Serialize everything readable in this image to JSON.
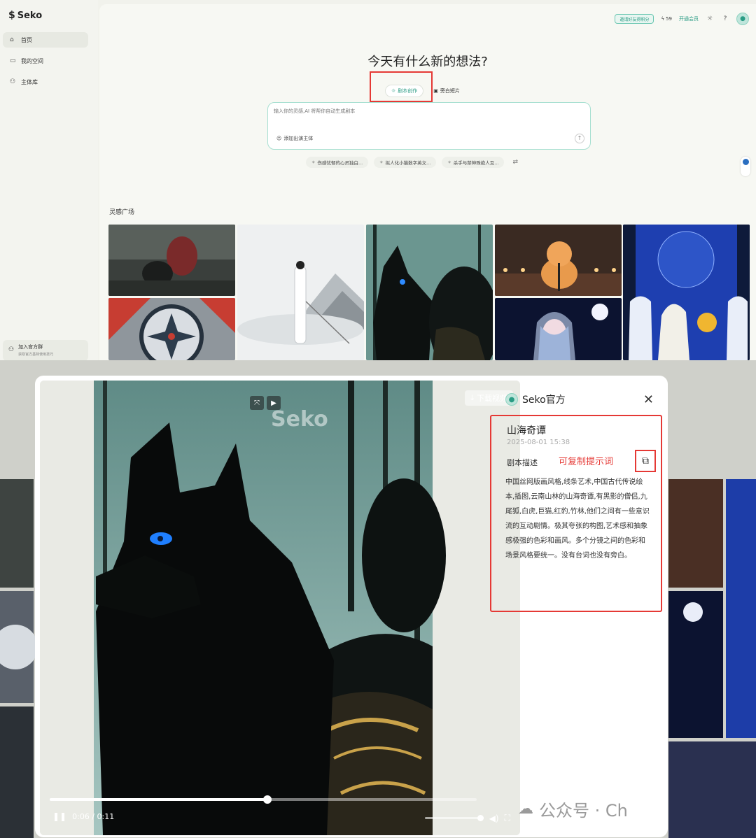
{
  "app": {
    "logo": "Seko",
    "nav": [
      {
        "label": "首页",
        "icon": "home-icon",
        "glyph": "⌂"
      },
      {
        "label": "我的空间",
        "icon": "folder-icon",
        "glyph": "▭"
      },
      {
        "label": "主体库",
        "icon": "people-icon",
        "glyph": "⚇"
      }
    ],
    "join_group": {
      "title": "加入官方群",
      "subtitle": "获取官方基础使用技巧"
    }
  },
  "topbar": {
    "invite_label": "邀请好友得积分",
    "credits": "59",
    "open_member": "开通会员"
  },
  "headline": "今天有什么新的想法?",
  "mode_tabs": [
    {
      "label": "剧本创作",
      "icon": "lightbulb-icon",
      "glyph": "☼"
    },
    {
      "label": "旁白短片",
      "icon": "film-icon",
      "glyph": "▣"
    }
  ],
  "prompt": {
    "placeholder": "输入你的灵感,AI 将帮你自动生成剧本",
    "add_role": "添加出演主体"
  },
  "suggestions": [
    "伤感忧郁的心灵独白...",
    "拟人化小猫数字英文...",
    "杀手与禁神殊绝人互..."
  ],
  "gallery_title": "灵感广场",
  "video": {
    "watermark": "Seko",
    "download_label": "下载视频",
    "time": "0:06 / 0:11",
    "progress": 0.51
  },
  "detail": {
    "author": "Seko官方",
    "title": "山海奇谭",
    "time": "2025-08-01 15:38",
    "script_label": "剧本描述",
    "copy_hint": "可复制提示词",
    "script_text": "中国丝网版画风格,线条艺术,中国古代传说绘本,插图,云南山林的山海奇谭,有黑影的僧侣,九尾狐,白虎,巨猫,红豹,竹林,他们之间有一些意识流的互动剧情。极其夸张的构图,艺术感和抽象感极强的色彩和画风。多个分镜之间的色彩和场景风格要统一。没有台词也没有旁白。"
  },
  "corner_watermark": "公众号 · Ch"
}
